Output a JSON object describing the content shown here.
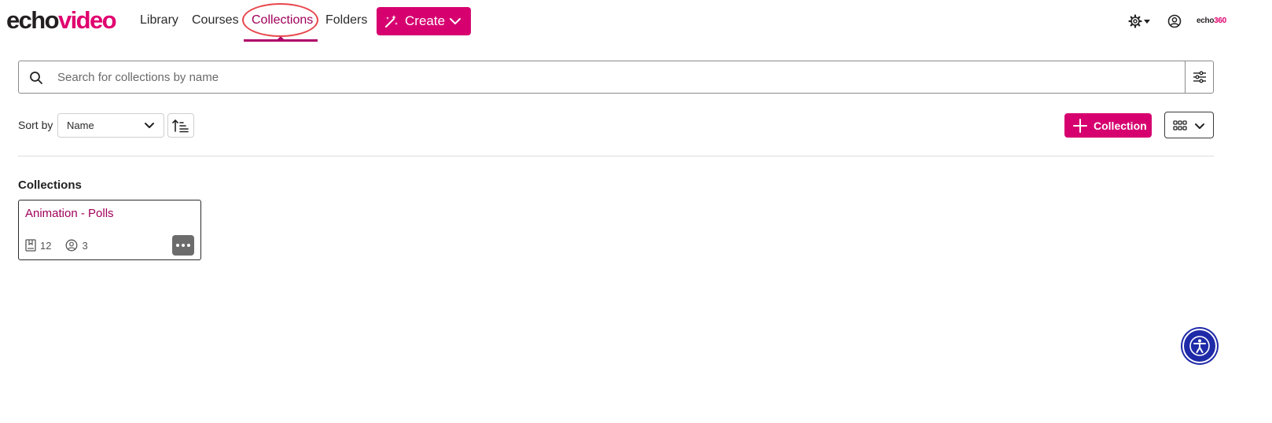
{
  "brand": {
    "logo_dark": "echo",
    "logo_pink": "video",
    "partner_dark": "echo",
    "partner_pink": "360"
  },
  "nav": {
    "library": "Library",
    "courses": "Courses",
    "collections": "Collections",
    "folders": "Folders",
    "create": "Create"
  },
  "search": {
    "placeholder": "Search for collections by name",
    "value": ""
  },
  "sort": {
    "label": "Sort by",
    "selected": "Name"
  },
  "actions": {
    "add_collection": "Collection"
  },
  "section": {
    "title": "Collections"
  },
  "collections": [
    {
      "title": "Animation - Polls",
      "media_count": "12",
      "member_count": "3"
    }
  ],
  "colors": {
    "accent": "#d6006f",
    "active_link": "#a0005a",
    "annotation": "#e8474c",
    "accessibility": "#1f2aa8"
  },
  "icons": [
    "settings-icon",
    "user-account-icon",
    "search-icon",
    "filter-icon",
    "sort-direction-icon",
    "grid-view-icon",
    "plus-icon",
    "media-icon",
    "members-icon",
    "more-options-icon",
    "accessibility-icon",
    "magic-wand-icon"
  ]
}
